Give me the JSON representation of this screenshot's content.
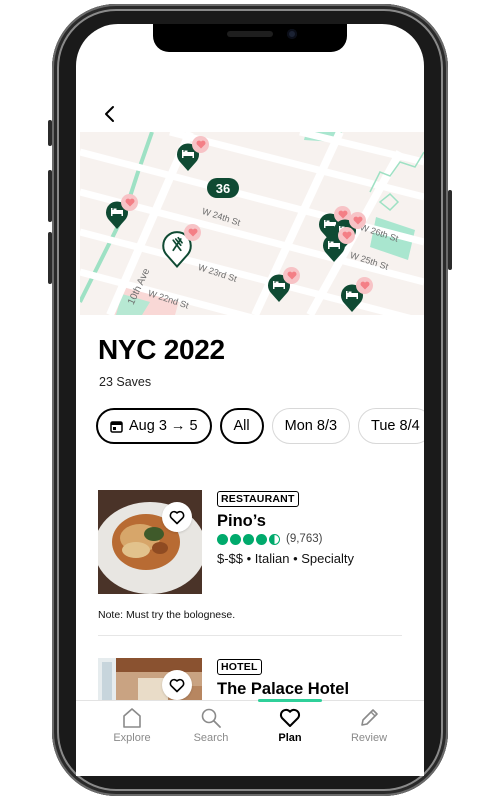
{
  "header": {
    "back_icon": "chevron-left-icon"
  },
  "map": {
    "street_labels": [
      "W 24th St",
      "W 23rd St",
      "10th Ave",
      "W 22nd St",
      "W 25th St",
      "W 26th St"
    ],
    "cluster_count": "36",
    "pins": [
      {
        "type": "hotel",
        "saved": true
      },
      {
        "type": "hotel",
        "saved": true
      },
      {
        "type": "restaurant",
        "saved": true,
        "selected": true
      },
      {
        "type": "hotel",
        "saved": true
      },
      {
        "type": "hotel",
        "saved": true
      },
      {
        "type": "hotel",
        "saved": true
      },
      {
        "type": "hotel",
        "saved": true
      },
      {
        "type": "hotel",
        "saved": true
      }
    ]
  },
  "trip": {
    "title": "NYC 2022",
    "saves": "23 Saves"
  },
  "filters": [
    {
      "label": "Aug 3 → 5",
      "icon": "calendar-icon",
      "selected": true
    },
    {
      "label": "All",
      "selected": true
    },
    {
      "label": "Mon 8/3",
      "selected": false
    },
    {
      "label": "Tue 8/4",
      "selected": false
    }
  ],
  "items": [
    {
      "category": "RESTAURANT",
      "name": "Pino’s",
      "rating": 4.5,
      "reviews": "(9,763)",
      "meta": "$-$$ • Italian • Specialty",
      "note": "Note: Must try the bolognese.",
      "favorite_icon": "heart-outline-icon"
    },
    {
      "category": "HOTEL",
      "name": "The Palace Hotel",
      "favorite_icon": "heart-outline-icon"
    }
  ],
  "tabbar": {
    "tabs": [
      {
        "label": "Explore",
        "icon": "home-icon",
        "active": false
      },
      {
        "label": "Search",
        "icon": "search-icon",
        "active": false
      },
      {
        "label": "Plan",
        "icon": "heart-icon",
        "active": true
      },
      {
        "label": "Review",
        "icon": "pencil-icon",
        "active": false
      }
    ]
  },
  "colors": {
    "brand_dark_green": "#0f4a33",
    "rating_green": "#00aa6c",
    "tab_accent": "#2fd09a",
    "heart_pink": "#f47f86"
  }
}
